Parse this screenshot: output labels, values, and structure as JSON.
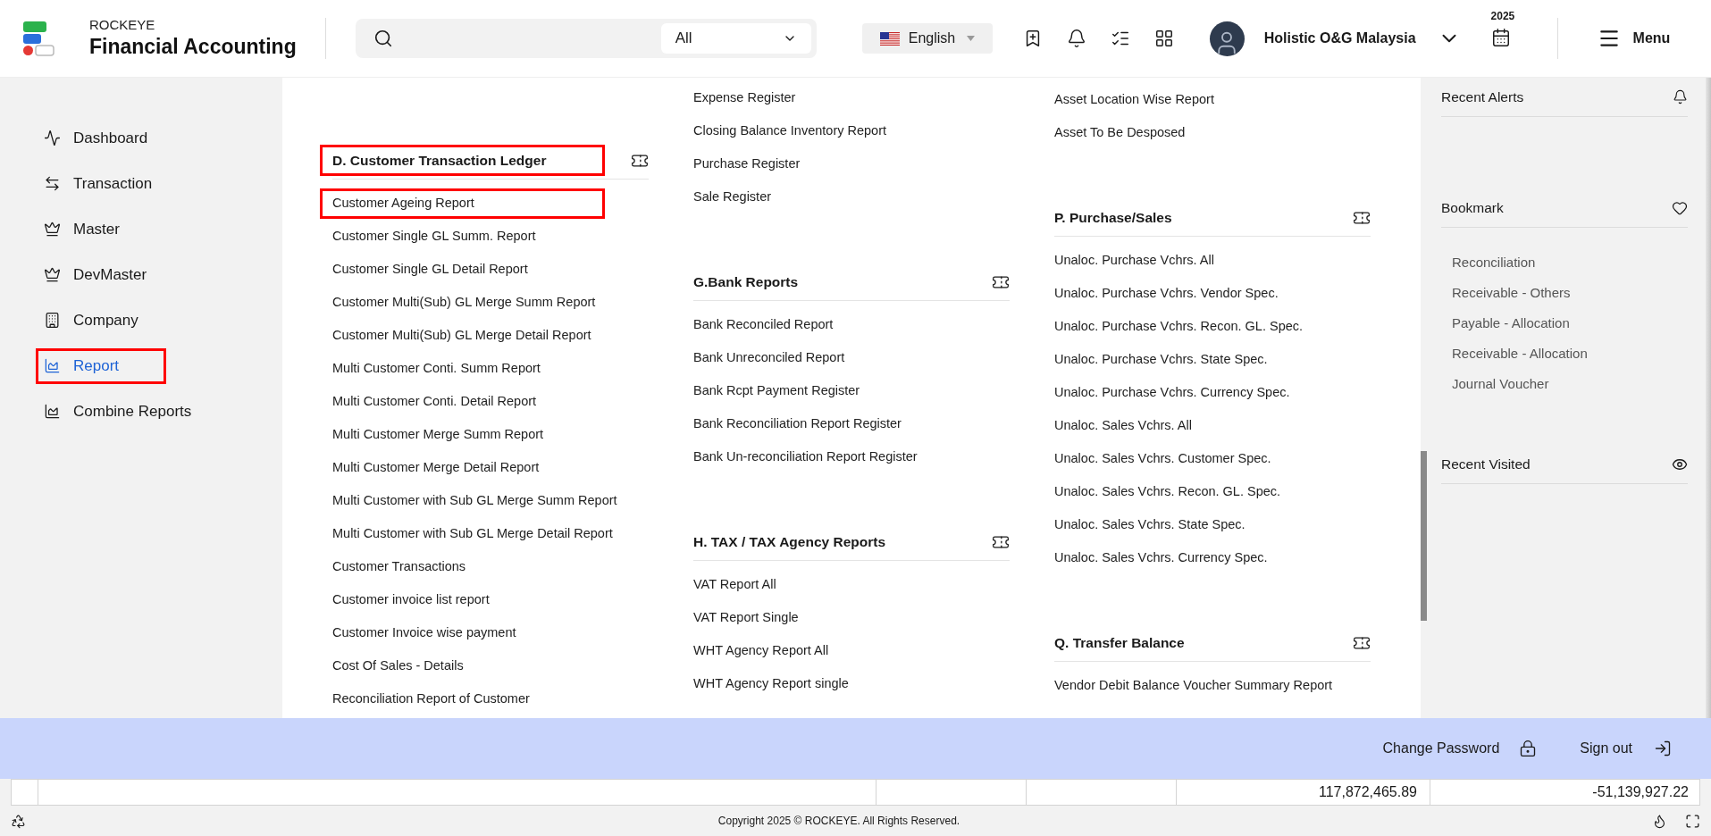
{
  "header": {
    "brand_top": "ROCKEYE",
    "brand_name": "Financial Accounting",
    "search_filter": "All",
    "language": "English",
    "user_name": "Holistic O&G Malaysia",
    "year_badge": "2025",
    "menu_label": "Menu"
  },
  "sidebar": {
    "items": [
      {
        "label": "Dashboard",
        "selected": false,
        "highlighted": false
      },
      {
        "label": "Transaction",
        "selected": false,
        "highlighted": false
      },
      {
        "label": "Master",
        "selected": false,
        "highlighted": false
      },
      {
        "label": "DevMaster",
        "selected": false,
        "highlighted": false
      },
      {
        "label": "Company",
        "selected": false,
        "highlighted": false
      },
      {
        "label": "Report",
        "selected": true,
        "highlighted": true
      },
      {
        "label": "Combine Reports",
        "selected": false,
        "highlighted": false
      }
    ]
  },
  "report_columns": [
    {
      "sections": [
        {
          "heading": "D. Customer Transaction Ledger",
          "heading_highlighted": true,
          "items": [
            {
              "label": "Customer Ageing Report",
              "highlighted": true
            },
            {
              "label": "Customer Single GL Summ. Report",
              "highlighted": false
            },
            {
              "label": "Customer Single GL Detail Report",
              "highlighted": false
            },
            {
              "label": "Customer Multi(Sub) GL Merge Summ Report",
              "highlighted": false
            },
            {
              "label": "Customer Multi(Sub) GL Merge Detail Report",
              "highlighted": false
            },
            {
              "label": "Multi Customer Conti. Summ Report",
              "highlighted": false
            },
            {
              "label": "Multi Customer Conti. Detail Report",
              "highlighted": false
            },
            {
              "label": "Multi Customer Merge Summ Report",
              "highlighted": false
            },
            {
              "label": "Multi Customer Merge Detail Report",
              "highlighted": false
            },
            {
              "label": "Multi Customer with Sub GL Merge Summ Report",
              "highlighted": false
            },
            {
              "label": "Multi Customer with Sub GL Merge Detail Report",
              "highlighted": false
            },
            {
              "label": "Customer Transactions",
              "highlighted": false
            },
            {
              "label": "Customer invoice list report",
              "highlighted": false
            },
            {
              "label": "Customer Invoice wise payment",
              "highlighted": false
            },
            {
              "label": "Cost Of Sales - Details",
              "highlighted": false
            },
            {
              "label": "Reconciliation Report of Customer",
              "highlighted": false
            }
          ]
        }
      ]
    },
    {
      "sections": [
        {
          "items": [
            {
              "label": "Expense Register",
              "highlighted": false
            },
            {
              "label": "Closing Balance Inventory Report",
              "highlighted": false
            },
            {
              "label": "Purchase Register",
              "highlighted": false
            },
            {
              "label": "Sale Register",
              "highlighted": false
            }
          ]
        },
        {
          "heading": "G.Bank Reports",
          "heading_highlighted": false,
          "items": [
            {
              "label": "Bank Reconciled Report",
              "highlighted": false
            },
            {
              "label": "Bank Unreconciled Report",
              "highlighted": false
            },
            {
              "label": "Bank Rcpt Payment Register",
              "highlighted": false
            },
            {
              "label": "Bank Reconciliation Report Register",
              "highlighted": false
            },
            {
              "label": "Bank Un-reconciliation Report Register",
              "highlighted": false
            }
          ]
        },
        {
          "heading": "H. TAX / TAX Agency Reports",
          "heading_highlighted": false,
          "items": [
            {
              "label": "VAT Report All",
              "highlighted": false
            },
            {
              "label": "VAT Report Single",
              "highlighted": false
            },
            {
              "label": "WHT Agency Report All",
              "highlighted": false
            },
            {
              "label": "WHT Agency Report single",
              "highlighted": false
            }
          ]
        }
      ]
    },
    {
      "sections": [
        {
          "items": [
            {
              "label": "Asset Location Wise Report",
              "highlighted": false
            },
            {
              "label": "Asset To Be Desposed",
              "highlighted": false
            }
          ]
        },
        {
          "heading": "P. Purchase/Sales",
          "heading_highlighted": false,
          "items": [
            {
              "label": "Unaloc. Purchase Vchrs. All",
              "highlighted": false
            },
            {
              "label": "Unaloc. Purchase Vchrs. Vendor Spec.",
              "highlighted": false
            },
            {
              "label": "Unaloc. Purchase Vchrs. Recon. GL. Spec.",
              "highlighted": false
            },
            {
              "label": "Unaloc. Purchase Vchrs. State Spec.",
              "highlighted": false
            },
            {
              "label": "Unaloc. Purchase Vchrs. Currency Spec.",
              "highlighted": false
            },
            {
              "label": "Unaloc. Sales Vchrs. All",
              "highlighted": false
            },
            {
              "label": "Unaloc. Sales Vchrs. Customer Spec.",
              "highlighted": false
            },
            {
              "label": "Unaloc. Sales Vchrs. Recon. GL. Spec.",
              "highlighted": false
            },
            {
              "label": "Unaloc. Sales Vchrs. State Spec.",
              "highlighted": false
            },
            {
              "label": "Unaloc. Sales Vchrs. Currency Spec.",
              "highlighted": false
            }
          ]
        },
        {
          "heading": "Q. Transfer Balance",
          "heading_highlighted": false,
          "items": [
            {
              "label": "Vendor Debit Balance Voucher Summary Report",
              "highlighted": false
            }
          ]
        }
      ]
    }
  ],
  "right_panel": {
    "alerts_title": "Recent Alerts",
    "bookmark_title": "Bookmark",
    "bookmarks": [
      "Reconciliation",
      "Receivable - Others",
      "Payable - Allocation",
      "Receivable - Allocation",
      "Journal Voucher"
    ],
    "visited_title": "Recent Visited"
  },
  "account_bar": {
    "change_password": "Change Password",
    "sign_out": "Sign out"
  },
  "totals_row": {
    "column_5": "117,872,465.89",
    "column_6": "-51,139,927.22"
  },
  "footer": {
    "copyright": "Copyright 2025 © ROCKEYE. All Rights Reserved."
  }
}
